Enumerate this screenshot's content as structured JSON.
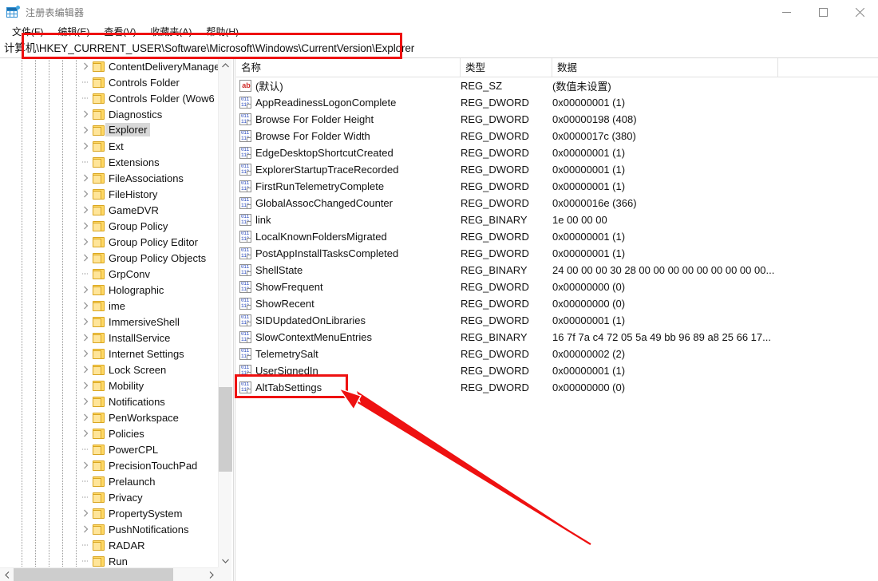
{
  "window": {
    "title": "注册表编辑器",
    "icon": "registry-editor-icon",
    "controls": {
      "minimize": "minimize-icon",
      "maximize": "maximize-icon",
      "close": "close-icon"
    }
  },
  "menubar": {
    "items": [
      {
        "label": "文件(F)"
      },
      {
        "label": "编辑(E)"
      },
      {
        "label": "查看(V)"
      },
      {
        "label": "收藏夹(A)"
      },
      {
        "label": "帮助(H)"
      }
    ]
  },
  "address": {
    "value": "计算机\\HKEY_CURRENT_USER\\Software\\Microsoft\\Windows\\CurrentVersion\\Explorer"
  },
  "tree": {
    "items": [
      {
        "label": "ContentDeliveryManage",
        "expandable": true,
        "selected": false
      },
      {
        "label": "Controls Folder",
        "expandable": false,
        "selected": false
      },
      {
        "label": "Controls Folder (Wow6",
        "expandable": false,
        "selected": false
      },
      {
        "label": "Diagnostics",
        "expandable": true,
        "selected": false
      },
      {
        "label": "Explorer",
        "expandable": true,
        "selected": true
      },
      {
        "label": "Ext",
        "expandable": true,
        "selected": false
      },
      {
        "label": "Extensions",
        "expandable": false,
        "selected": false
      },
      {
        "label": "FileAssociations",
        "expandable": true,
        "selected": false
      },
      {
        "label": "FileHistory",
        "expandable": true,
        "selected": false
      },
      {
        "label": "GameDVR",
        "expandable": true,
        "selected": false
      },
      {
        "label": "Group Policy",
        "expandable": true,
        "selected": false
      },
      {
        "label": "Group Policy Editor",
        "expandable": true,
        "selected": false
      },
      {
        "label": "Group Policy Objects",
        "expandable": true,
        "selected": false
      },
      {
        "label": "GrpConv",
        "expandable": false,
        "selected": false
      },
      {
        "label": "Holographic",
        "expandable": true,
        "selected": false
      },
      {
        "label": "ime",
        "expandable": true,
        "selected": false
      },
      {
        "label": "ImmersiveShell",
        "expandable": true,
        "selected": false
      },
      {
        "label": "InstallService",
        "expandable": true,
        "selected": false
      },
      {
        "label": "Internet Settings",
        "expandable": true,
        "selected": false
      },
      {
        "label": "Lock Screen",
        "expandable": true,
        "selected": false
      },
      {
        "label": "Mobility",
        "expandable": true,
        "selected": false
      },
      {
        "label": "Notifications",
        "expandable": true,
        "selected": false
      },
      {
        "label": "PenWorkspace",
        "expandable": true,
        "selected": false
      },
      {
        "label": "Policies",
        "expandable": true,
        "selected": false
      },
      {
        "label": "PowerCPL",
        "expandable": false,
        "selected": false
      },
      {
        "label": "PrecisionTouchPad",
        "expandable": true,
        "selected": false
      },
      {
        "label": "Prelaunch",
        "expandable": false,
        "selected": false
      },
      {
        "label": "Privacy",
        "expandable": false,
        "selected": false
      },
      {
        "label": "PropertySystem",
        "expandable": true,
        "selected": false
      },
      {
        "label": "PushNotifications",
        "expandable": true,
        "selected": false
      },
      {
        "label": "RADAR",
        "expandable": false,
        "selected": false
      },
      {
        "label": "Run",
        "expandable": false,
        "selected": false
      }
    ]
  },
  "list": {
    "columns": [
      {
        "label": "名称"
      },
      {
        "label": "类型"
      },
      {
        "label": "数据"
      }
    ],
    "rows": [
      {
        "name": "(默认)",
        "type": "REG_SZ",
        "data": "(数值未设置)",
        "icon": "string-value-icon"
      },
      {
        "name": "AppReadinessLogonComplete",
        "type": "REG_DWORD",
        "data": "0x00000001 (1)",
        "icon": "binary-value-icon"
      },
      {
        "name": "Browse For Folder Height",
        "type": "REG_DWORD",
        "data": "0x00000198 (408)",
        "icon": "binary-value-icon"
      },
      {
        "name": "Browse For Folder Width",
        "type": "REG_DWORD",
        "data": "0x0000017c (380)",
        "icon": "binary-value-icon"
      },
      {
        "name": "EdgeDesktopShortcutCreated",
        "type": "REG_DWORD",
        "data": "0x00000001 (1)",
        "icon": "binary-value-icon"
      },
      {
        "name": "ExplorerStartupTraceRecorded",
        "type": "REG_DWORD",
        "data": "0x00000001 (1)",
        "icon": "binary-value-icon"
      },
      {
        "name": "FirstRunTelemetryComplete",
        "type": "REG_DWORD",
        "data": "0x00000001 (1)",
        "icon": "binary-value-icon"
      },
      {
        "name": "GlobalAssocChangedCounter",
        "type": "REG_DWORD",
        "data": "0x0000016e (366)",
        "icon": "binary-value-icon"
      },
      {
        "name": "link",
        "type": "REG_BINARY",
        "data": "1e 00 00 00",
        "icon": "binary-value-icon"
      },
      {
        "name": "LocalKnownFoldersMigrated",
        "type": "REG_DWORD",
        "data": "0x00000001 (1)",
        "icon": "binary-value-icon"
      },
      {
        "name": "PostAppInstallTasksCompleted",
        "type": "REG_DWORD",
        "data": "0x00000001 (1)",
        "icon": "binary-value-icon"
      },
      {
        "name": "ShellState",
        "type": "REG_BINARY",
        "data": "24 00 00 00 30 28 00 00 00 00 00 00 00 00 00...",
        "icon": "binary-value-icon"
      },
      {
        "name": "ShowFrequent",
        "type": "REG_DWORD",
        "data": "0x00000000 (0)",
        "icon": "binary-value-icon"
      },
      {
        "name": "ShowRecent",
        "type": "REG_DWORD",
        "data": "0x00000000 (0)",
        "icon": "binary-value-icon"
      },
      {
        "name": "SIDUpdatedOnLibraries",
        "type": "REG_DWORD",
        "data": "0x00000001 (1)",
        "icon": "binary-value-icon"
      },
      {
        "name": "SlowContextMenuEntries",
        "type": "REG_BINARY",
        "data": "16 7f 7a c4 72 05 5a 49 bb 96 89 a8 25 66 17...",
        "icon": "binary-value-icon"
      },
      {
        "name": "TelemetrySalt",
        "type": "REG_DWORD",
        "data": "0x00000002 (2)",
        "icon": "binary-value-icon"
      },
      {
        "name": "UserSignedIn",
        "type": "REG_DWORD",
        "data": "0x00000001 (1)",
        "icon": "binary-value-icon"
      },
      {
        "name": "AltTabSettings",
        "type": "REG_DWORD",
        "data": "0x00000000 (0)",
        "icon": "binary-value-icon"
      }
    ]
  },
  "annotations": {
    "highlight_color": "#ee1111",
    "address_box_target": "计算机\\HKEY_CURRENT_USER\\Software\\Microsoft\\Windows\\CurrentVersion\\Explorer",
    "value_box_target": "AltTabSettings"
  }
}
